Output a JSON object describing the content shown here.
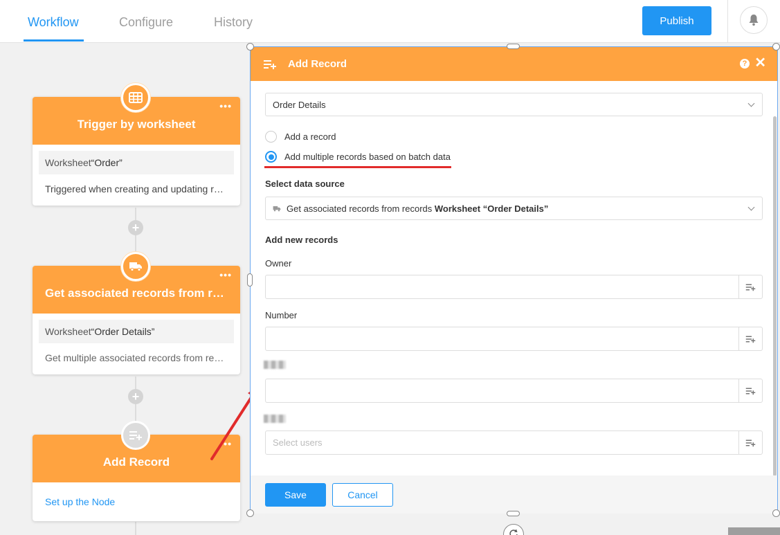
{
  "topbar": {
    "tabs": [
      {
        "label": "Workflow",
        "active": true
      },
      {
        "label": "Configure",
        "active": false
      },
      {
        "label": "History",
        "active": false
      }
    ],
    "publish_label": "Publish",
    "notification_icon": "bell-icon"
  },
  "nodes": [
    {
      "title": "Trigger by worksheet",
      "icon": "table-grid-icon",
      "worksheet_prefix": "Worksheet",
      "worksheet_name": "“Order”",
      "description": "Triggered when creating and updating records"
    },
    {
      "title": "Get associated records from records",
      "icon": "truck-icon",
      "worksheet_prefix": "Worksheet",
      "worksheet_name": "“Order Details”",
      "description": "Get multiple associated records from records"
    },
    {
      "title": "Add Record",
      "icon": "add-record-icon",
      "link": "Set up the Node"
    }
  ],
  "panel": {
    "title": "Add Record",
    "worksheet_select": "Order Details",
    "mode_options": [
      {
        "label": "Add a record",
        "checked": false
      },
      {
        "label": "Add multiple records based on batch data",
        "checked": true
      }
    ],
    "data_source_label": "Select data source",
    "data_source": {
      "prefix": "Get associated records from records",
      "bold": "Worksheet “Order Details”"
    },
    "new_records_label": "Add new records",
    "fields": [
      {
        "label": "Owner",
        "placeholder": ""
      },
      {
        "label": "Number",
        "placeholder": ""
      },
      {
        "label": "",
        "placeholder": ""
      },
      {
        "label": "",
        "placeholder": "Select users"
      }
    ],
    "save_label": "Save",
    "cancel_label": "Cancel"
  },
  "colors": {
    "accent": "#2196f3",
    "node_orange": "#ffa340",
    "annotation_red": "#e12b2b"
  }
}
